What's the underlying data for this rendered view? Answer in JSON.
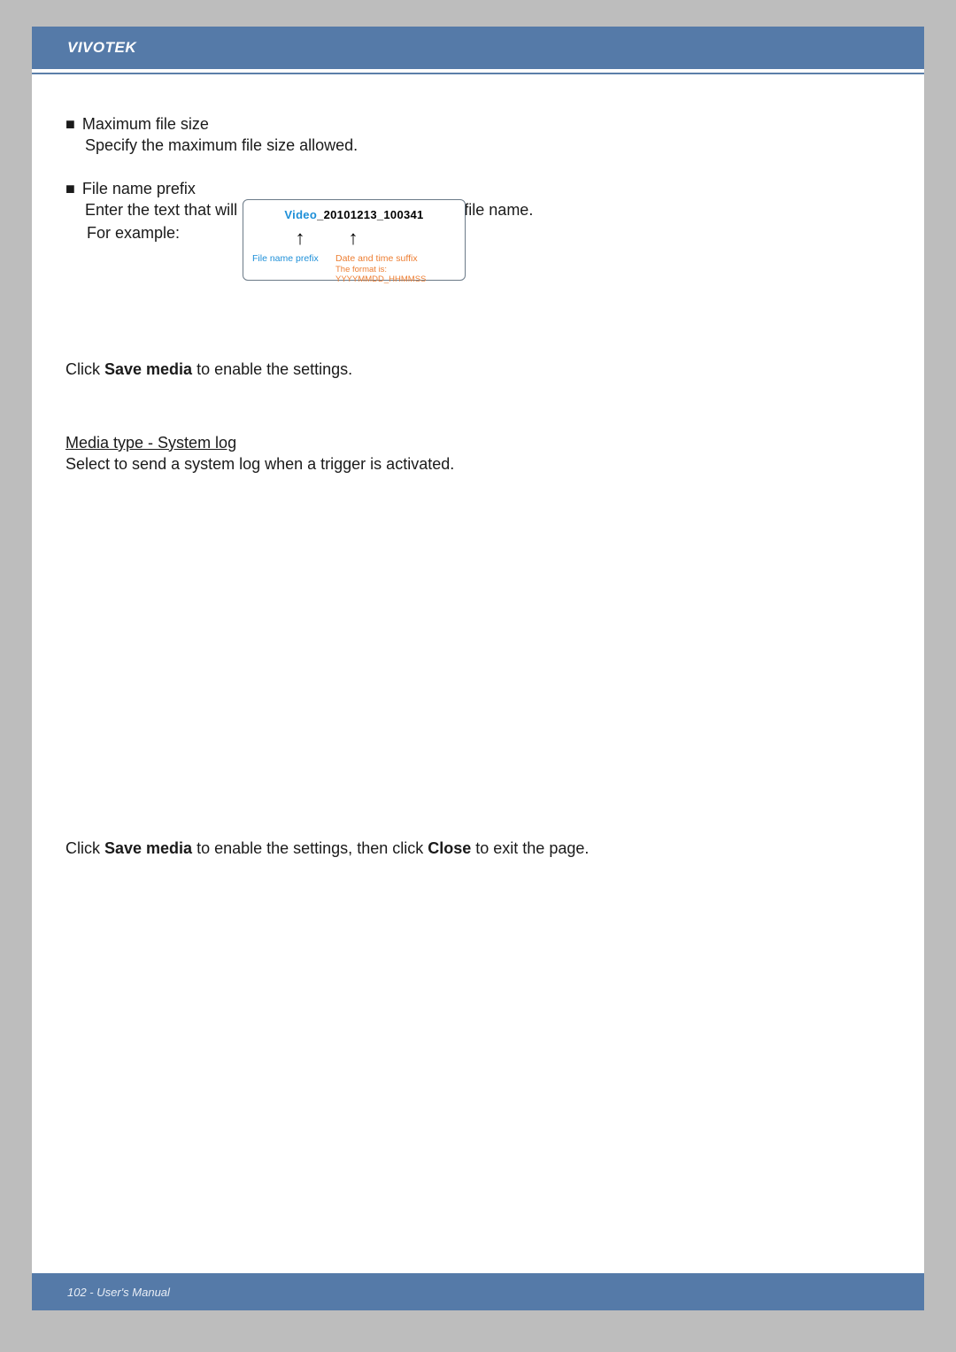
{
  "header": {
    "brand": "VIVOTEK"
  },
  "bullets": {
    "b1_title": "Maximum file size",
    "b1_desc": "Specify the maximum file size allowed.",
    "b2_title": "File name prefix",
    "b2_desc": "Enter the text that will be appended to the front of the file name.",
    "b2_example_label": "For example:"
  },
  "diagram": {
    "prefix": "Video",
    "under": "_",
    "suffix": "20101213_100341",
    "arrow": "↑",
    "label_prefix": "File name prefix",
    "label_suffix": "Date and time suffix",
    "label_format": "The format is: YYYYMMDD_HHMMSS"
  },
  "paras": {
    "p1_a": "Click ",
    "p1_b": "Save media",
    "p1_c": " to enable the settings.",
    "p2_title": "Media type - System log",
    "p2_body": "Select to send a system log when a trigger is activated.",
    "p3_a": "Click ",
    "p3_b": "Save media",
    "p3_c": " to enable the settings, then click ",
    "p3_d": "Close",
    "p3_e": " to exit the page."
  },
  "footer": {
    "text": "102 - User's Manual"
  }
}
